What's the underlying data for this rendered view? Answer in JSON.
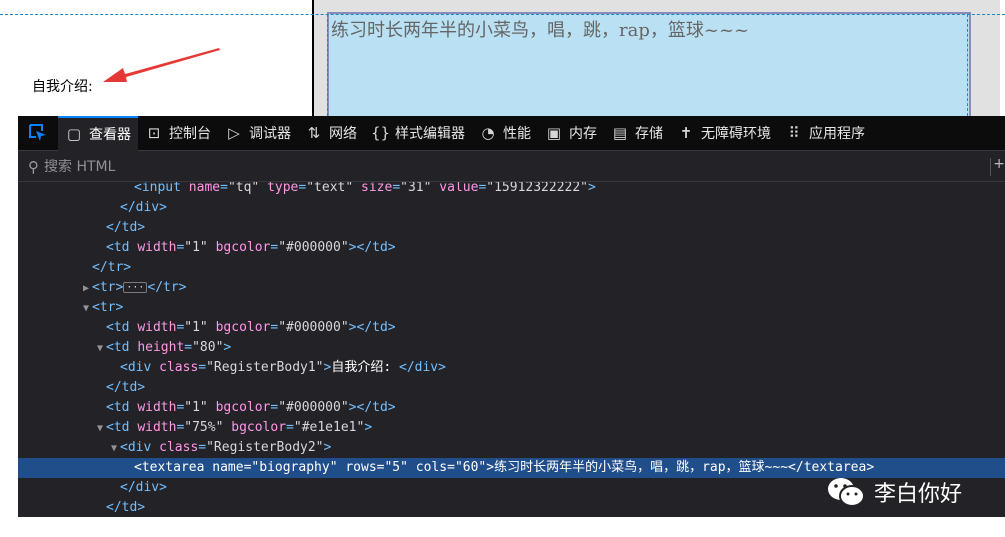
{
  "page_preview": {
    "intro_label": "自我介绍:",
    "textarea_value": "练习时长两年半的小菜鸟，唱，跳，rap，篮球~~~"
  },
  "devtools": {
    "tabs": [
      {
        "icon": "inspector-icon",
        "label": "查看器"
      },
      {
        "icon": "console-icon",
        "label": "控制台"
      },
      {
        "icon": "debugger-icon",
        "label": "调试器"
      },
      {
        "icon": "network-icon",
        "label": "网络"
      },
      {
        "icon": "style-editor-icon",
        "label": "样式编辑器"
      },
      {
        "icon": "performance-icon",
        "label": "性能"
      },
      {
        "icon": "memory-icon",
        "label": "内存"
      },
      {
        "icon": "storage-icon",
        "label": "存储"
      },
      {
        "icon": "accessibility-icon",
        "label": "无障碍环境"
      },
      {
        "icon": "application-icon",
        "label": "应用程序"
      }
    ],
    "search_placeholder": "搜索 HTML",
    "accent_color": "#0a84ff",
    "selected_row_color": "#204e8a"
  },
  "markup": [
    {
      "indent": 8,
      "twisty": "",
      "tag_open": "<input",
      "attrs": [
        [
          "name",
          "tq"
        ],
        [
          "type",
          "text"
        ],
        [
          "size",
          "31"
        ],
        [
          "value",
          "15912322222"
        ]
      ],
      "tag_close": ">",
      "text": "",
      "end": "",
      "cut": true
    },
    {
      "indent": 7,
      "twisty": "",
      "tag_open": "</div>",
      "attrs": [],
      "tag_close": "",
      "text": "",
      "end": ""
    },
    {
      "indent": 6,
      "twisty": "",
      "tag_open": "</td>",
      "attrs": [],
      "tag_close": "",
      "text": "",
      "end": ""
    },
    {
      "indent": 6,
      "twisty": "",
      "tag_open": "<td",
      "attrs": [
        [
          "width",
          "1"
        ],
        [
          "bgcolor",
          "#000000"
        ]
      ],
      "tag_close": ">",
      "text": "",
      "end": "</td>"
    },
    {
      "indent": 5,
      "twisty": "",
      "tag_open": "</tr>",
      "attrs": [],
      "tag_close": "",
      "text": "",
      "end": ""
    },
    {
      "indent": 5,
      "twisty": "collapsed",
      "tag_open": "<tr>",
      "attrs": [],
      "tag_close": "",
      "text": "",
      "end": "</tr>",
      "ellipsis": true
    },
    {
      "indent": 5,
      "twisty": "expanded",
      "tag_open": "<tr>",
      "attrs": [],
      "tag_close": "",
      "text": "",
      "end": ""
    },
    {
      "indent": 6,
      "twisty": "",
      "tag_open": "<td",
      "attrs": [
        [
          "width",
          "1"
        ],
        [
          "bgcolor",
          "#000000"
        ]
      ],
      "tag_close": ">",
      "text": "",
      "end": "</td>"
    },
    {
      "indent": 6,
      "twisty": "expanded",
      "tag_open": "<td",
      "attrs": [
        [
          "height",
          "80"
        ]
      ],
      "tag_close": ">",
      "text": "",
      "end": ""
    },
    {
      "indent": 7,
      "twisty": "",
      "tag_open": "<div",
      "attrs": [
        [
          "class",
          "RegisterBody1"
        ]
      ],
      "tag_close": ">",
      "text": "自我介绍: ",
      "end": "</div>"
    },
    {
      "indent": 6,
      "twisty": "",
      "tag_open": "</td>",
      "attrs": [],
      "tag_close": "",
      "text": "",
      "end": ""
    },
    {
      "indent": 6,
      "twisty": "",
      "tag_open": "<td",
      "attrs": [
        [
          "width",
          "1"
        ],
        [
          "bgcolor",
          "#000000"
        ]
      ],
      "tag_close": ">",
      "text": "",
      "end": "</td>"
    },
    {
      "indent": 6,
      "twisty": "expanded",
      "tag_open": "<td",
      "attrs": [
        [
          "width",
          "75%"
        ],
        [
          "bgcolor",
          "#e1e1e1"
        ]
      ],
      "tag_close": ">",
      "text": "",
      "end": ""
    },
    {
      "indent": 7,
      "twisty": "expanded",
      "tag_open": "<div",
      "attrs": [
        [
          "class",
          "RegisterBody2"
        ]
      ],
      "tag_close": ">",
      "text": "",
      "end": ""
    },
    {
      "indent": 8,
      "twisty": "",
      "tag_open": "<textarea",
      "attrs": [
        [
          "name",
          "biography"
        ],
        [
          "rows",
          "5"
        ],
        [
          "cols",
          "60"
        ]
      ],
      "tag_close": ">",
      "text": "练习时长两年半的小菜鸟，唱，跳，rap，篮球~~~",
      "end": "</textarea>",
      "selected": true
    },
    {
      "indent": 7,
      "twisty": "",
      "tag_open": "</div>",
      "attrs": [],
      "tag_close": "",
      "text": "",
      "end": ""
    },
    {
      "indent": 6,
      "twisty": "",
      "tag_open": "</td>",
      "attrs": [],
      "tag_close": "",
      "text": "",
      "end": ""
    }
  ],
  "watermark": {
    "icon": "wechat-icon",
    "text": "李白你好"
  }
}
